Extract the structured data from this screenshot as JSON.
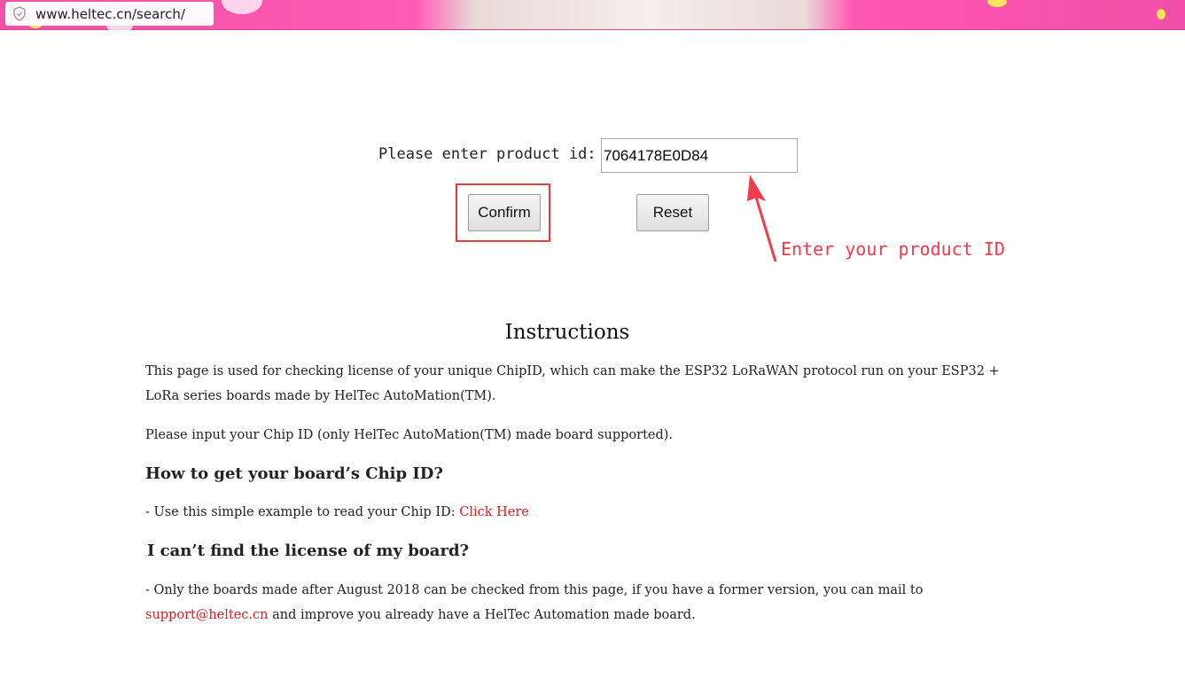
{
  "browser": {
    "url": "www.heltec.cn/search/"
  },
  "form": {
    "prompt": "Please enter product id:",
    "product_id_value": "7064178E0D84",
    "confirm_label": "Confirm",
    "reset_label": "Reset"
  },
  "annotation": {
    "text": "Enter your product ID",
    "color": "#f03c4d",
    "highlight_color": "#e63a3f"
  },
  "instructions": {
    "title": "Instructions",
    "para1": "This page is used for checking license of your unique ChipID, which can make the ESP32 LoRaWAN protocol run on your ESP32 + LoRa series boards made by HelTec AutoMation(TM).",
    "para2": "Please input your Chip ID (only HelTec AutoMation(TM) made board supported).",
    "heading_chipid": "How to get your board’s Chip ID?",
    "chipid_prefix": "- Use this simple example to read your Chip ID: ",
    "chipid_link": "Click Here",
    "heading_license": "I can’t find the license of my board?",
    "license_text": "- Only the boards made after August 2018 can be checked from this page, if you have a former version, you can mail to ",
    "license_email": "support@heltec.cn",
    "license_suffix": " and improve you already have a HelTec Automation made board."
  },
  "colors": {
    "link": "#d61f1f",
    "header_pink": "#f34fa6"
  }
}
